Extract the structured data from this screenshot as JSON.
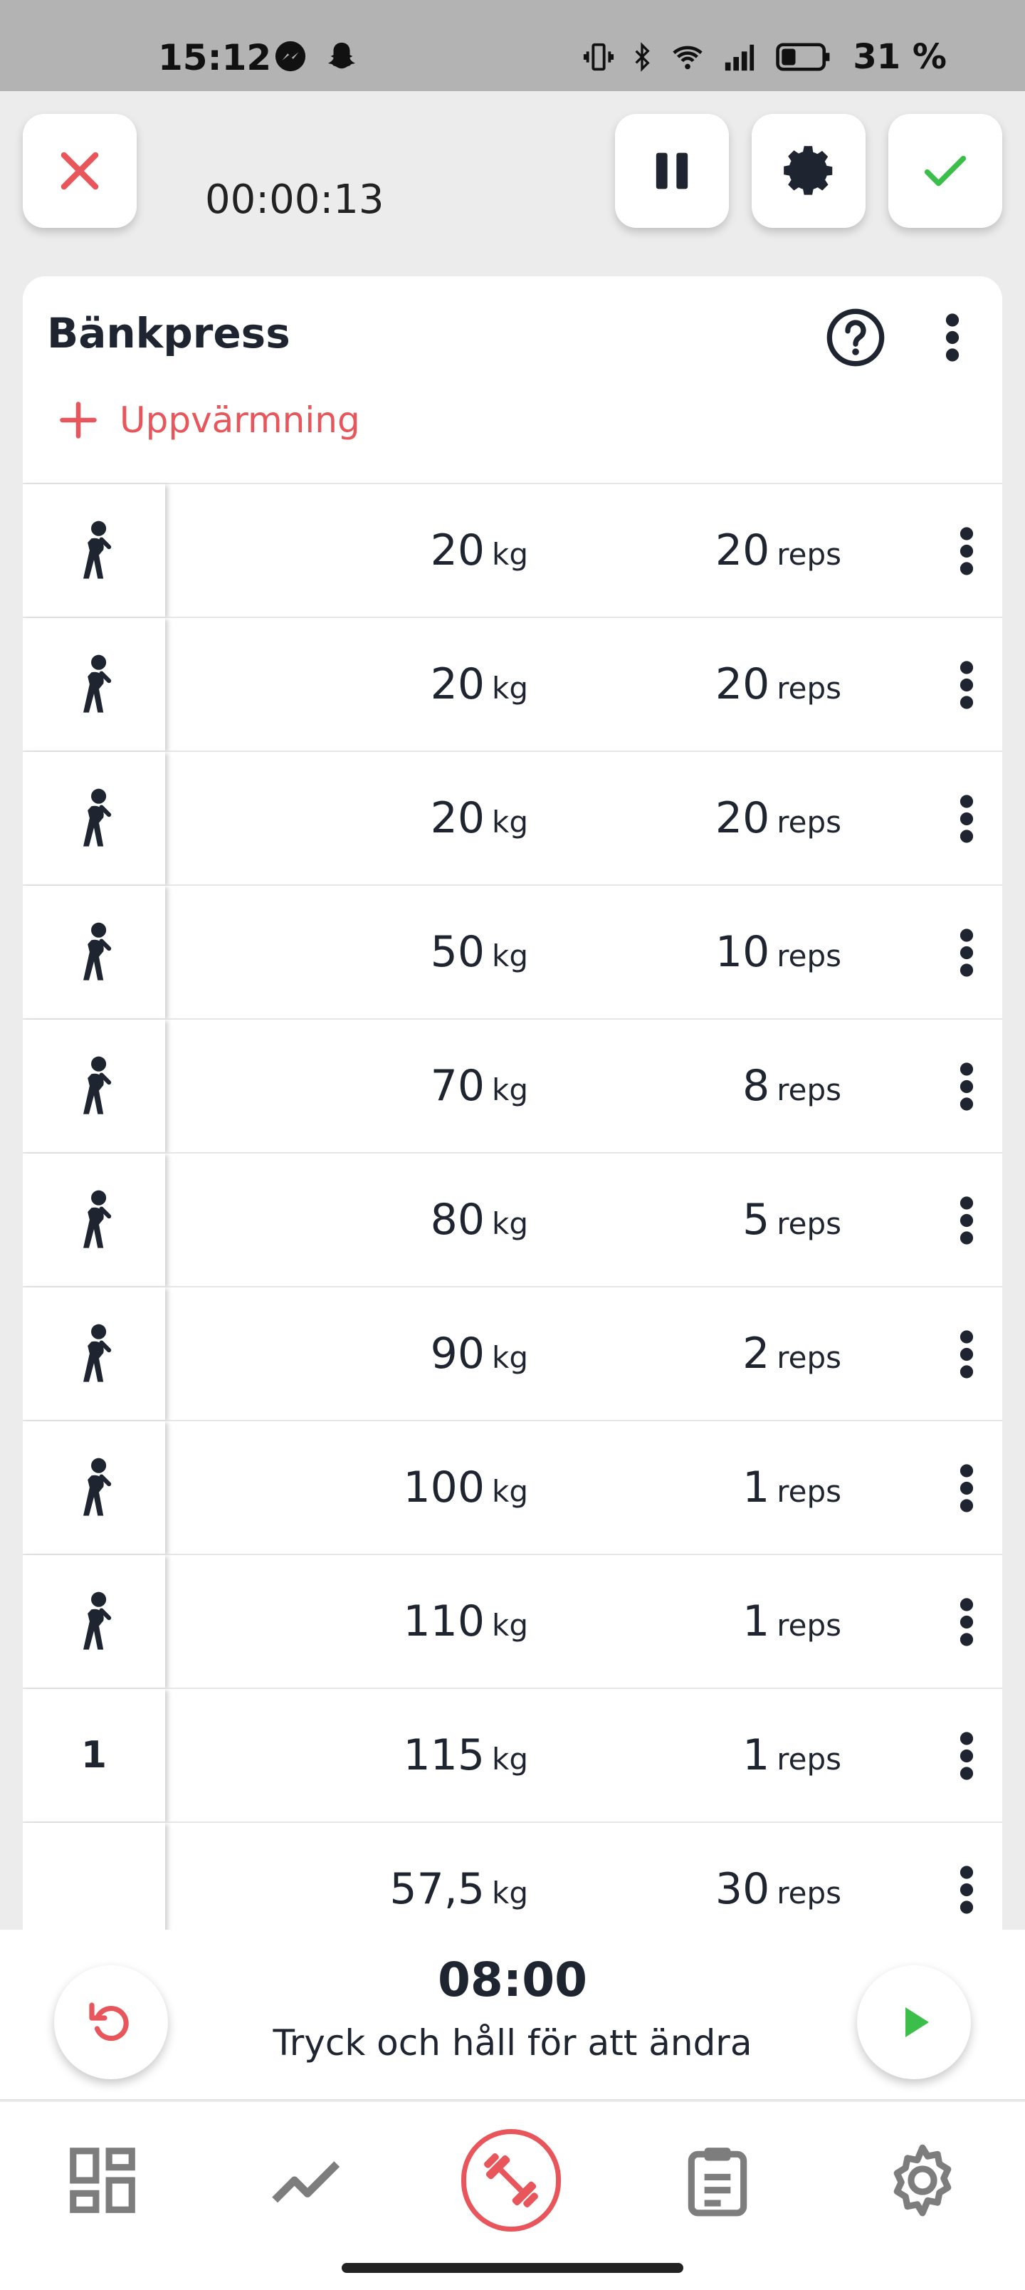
{
  "status_bar": {
    "time": "15:12",
    "battery": "31 %",
    "app_icons": [
      "messenger-icon",
      "snapchat-icon"
    ],
    "system_icons": [
      "vibrate-icon",
      "bluetooth-icon",
      "wifi-icon",
      "signal-icon",
      "battery-icon"
    ]
  },
  "header": {
    "elapsed": "00:00:13"
  },
  "exercise": {
    "title": "Bänkpress",
    "warmup_label": "Uppvärmning",
    "sets": [
      {
        "type": "warmup",
        "label": "",
        "weight": "20",
        "weight_unit": "kg",
        "reps": "20",
        "reps_unit": "reps"
      },
      {
        "type": "warmup",
        "label": "",
        "weight": "20",
        "weight_unit": "kg",
        "reps": "20",
        "reps_unit": "reps"
      },
      {
        "type": "warmup",
        "label": "",
        "weight": "20",
        "weight_unit": "kg",
        "reps": "20",
        "reps_unit": "reps"
      },
      {
        "type": "warmup",
        "label": "",
        "weight": "50",
        "weight_unit": "kg",
        "reps": "10",
        "reps_unit": "reps"
      },
      {
        "type": "warmup",
        "label": "",
        "weight": "70",
        "weight_unit": "kg",
        "reps": "8",
        "reps_unit": "reps"
      },
      {
        "type": "warmup",
        "label": "",
        "weight": "80",
        "weight_unit": "kg",
        "reps": "5",
        "reps_unit": "reps"
      },
      {
        "type": "warmup",
        "label": "",
        "weight": "90",
        "weight_unit": "kg",
        "reps": "2",
        "reps_unit": "reps"
      },
      {
        "type": "warmup",
        "label": "",
        "weight": "100",
        "weight_unit": "kg",
        "reps": "1",
        "reps_unit": "reps"
      },
      {
        "type": "warmup",
        "label": "",
        "weight": "110",
        "weight_unit": "kg",
        "reps": "1",
        "reps_unit": "reps"
      },
      {
        "type": "work",
        "label": "1",
        "weight": "115",
        "weight_unit": "kg",
        "reps": "1",
        "reps_unit": "reps"
      },
      {
        "type": "blank",
        "label": "",
        "weight": "57,5",
        "weight_unit": "kg",
        "reps": "30",
        "reps_unit": "reps"
      }
    ]
  },
  "rest_timer": {
    "time": "08:00",
    "hint": "Tryck och håll för att ändra"
  },
  "bottom_nav": {
    "items": [
      "dashboard-icon",
      "progress-chart-icon",
      "workout-barbell-icon",
      "log-clipboard-icon",
      "settings-gear-icon"
    ],
    "active": "workout-barbell-icon"
  },
  "colors": {
    "accent_red": "#e8555a",
    "accent_green": "#3cbf4a",
    "text_dark": "#1f2530",
    "icon_gray": "#7d7d7d"
  }
}
